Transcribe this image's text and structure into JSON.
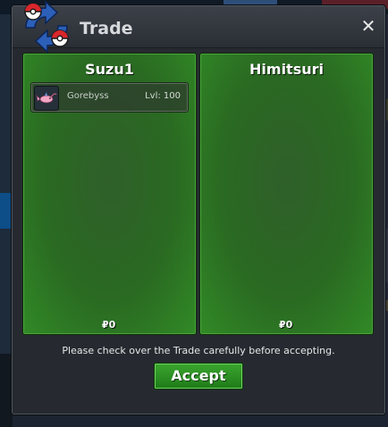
{
  "window": {
    "title": "Trade",
    "close_symbol": "✕"
  },
  "left_panel": {
    "name": "Suzu1",
    "items": [
      {
        "name": "Gorebyss",
        "level": "Lvl: 100"
      }
    ],
    "money": "₽0"
  },
  "right_panel": {
    "name": "Himitsuri",
    "items": [],
    "money": "₽0"
  },
  "notice": "Please check over the Trade carefully before accepting.",
  "accept_label": "Accept",
  "colors": {
    "panel_green": "#2a6a22",
    "accept_green": "#2e9326",
    "window_bg": "#262a30"
  },
  "icons": [
    "pokeball-logo-icon",
    "close-icon",
    "pokemon-icon"
  ]
}
